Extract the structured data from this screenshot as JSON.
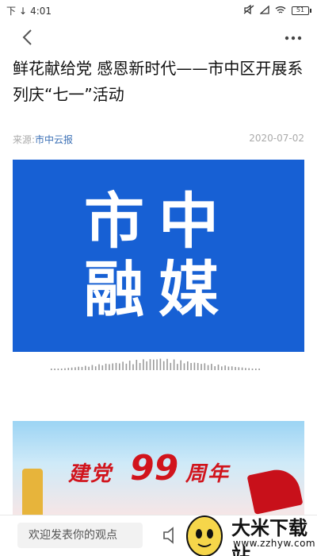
{
  "statusbar": {
    "carrier": "下",
    "time": "4:01",
    "battery": "51"
  },
  "article": {
    "title": "鲜花献给党 感恩新时代——市中区开展系列庆“七一”活动",
    "source_prefix": "来源:",
    "source_name": "市中云报",
    "date": "2020-07-02"
  },
  "banner": {
    "line1": "市中",
    "line2": "融媒",
    "bg_color": "#1760d4"
  },
  "banner2": {
    "text_left": "建党",
    "number": "99",
    "text_right": "周年"
  },
  "bottom": {
    "comment_placeholder": "欢迎发表你的观点",
    "brand_name": "大米下载站",
    "brand_url": "www.zzhyw.com"
  },
  "icons": [
    "back-icon",
    "more-icon",
    "speaker-icon",
    "wifi-icon",
    "signal-icon",
    "battery-icon",
    "mute-icon"
  ]
}
